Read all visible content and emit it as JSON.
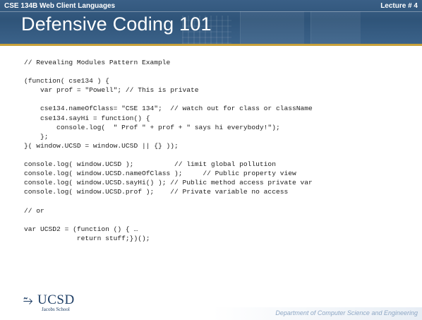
{
  "header": {
    "course": "CSE 134B  Web Client Languages",
    "lecture": "Lecture # 4",
    "title": "Defensive Coding 101"
  },
  "code_lines": [
    "// Revealing Modules Pattern Example",
    "",
    "(function( cse134 ) {",
    "    var prof = \"Powell\"; // This is private",
    "",
    "    cse134.nameOfClass= \"CSE 134\";  // watch out for class or className",
    "    cse134.sayHi = function() {",
    "        console.log(  \" Prof \" + prof + \" says hi everybody!\");",
    "    };",
    "}( window.UCSD = window.UCSD || {} ));",
    "",
    "console.log( window.UCSD );          // limit global pollution",
    "console.log( window.UCSD.nameOfClass );     // Public property view",
    "console.log( window.UCSD.sayHi() ); // Public method access private var",
    "console.log( window.UCSD.prof );    // Private variable no access",
    "",
    "// or",
    "",
    "var UCSD2 = (function () { …",
    "             return stuff;})();"
  ],
  "footer": {
    "logo_name": "UCSD",
    "logo_sub": "Jacobs School",
    "department": "Department of Computer Science and Engineering"
  },
  "colors": {
    "header_blue": "#345a80",
    "accent_gold": "#c8a13a",
    "logo_navy": "#1f3f66",
    "footer_text": "#8ea7c4"
  },
  "icons": {
    "logo_mark": "trident-icon"
  }
}
